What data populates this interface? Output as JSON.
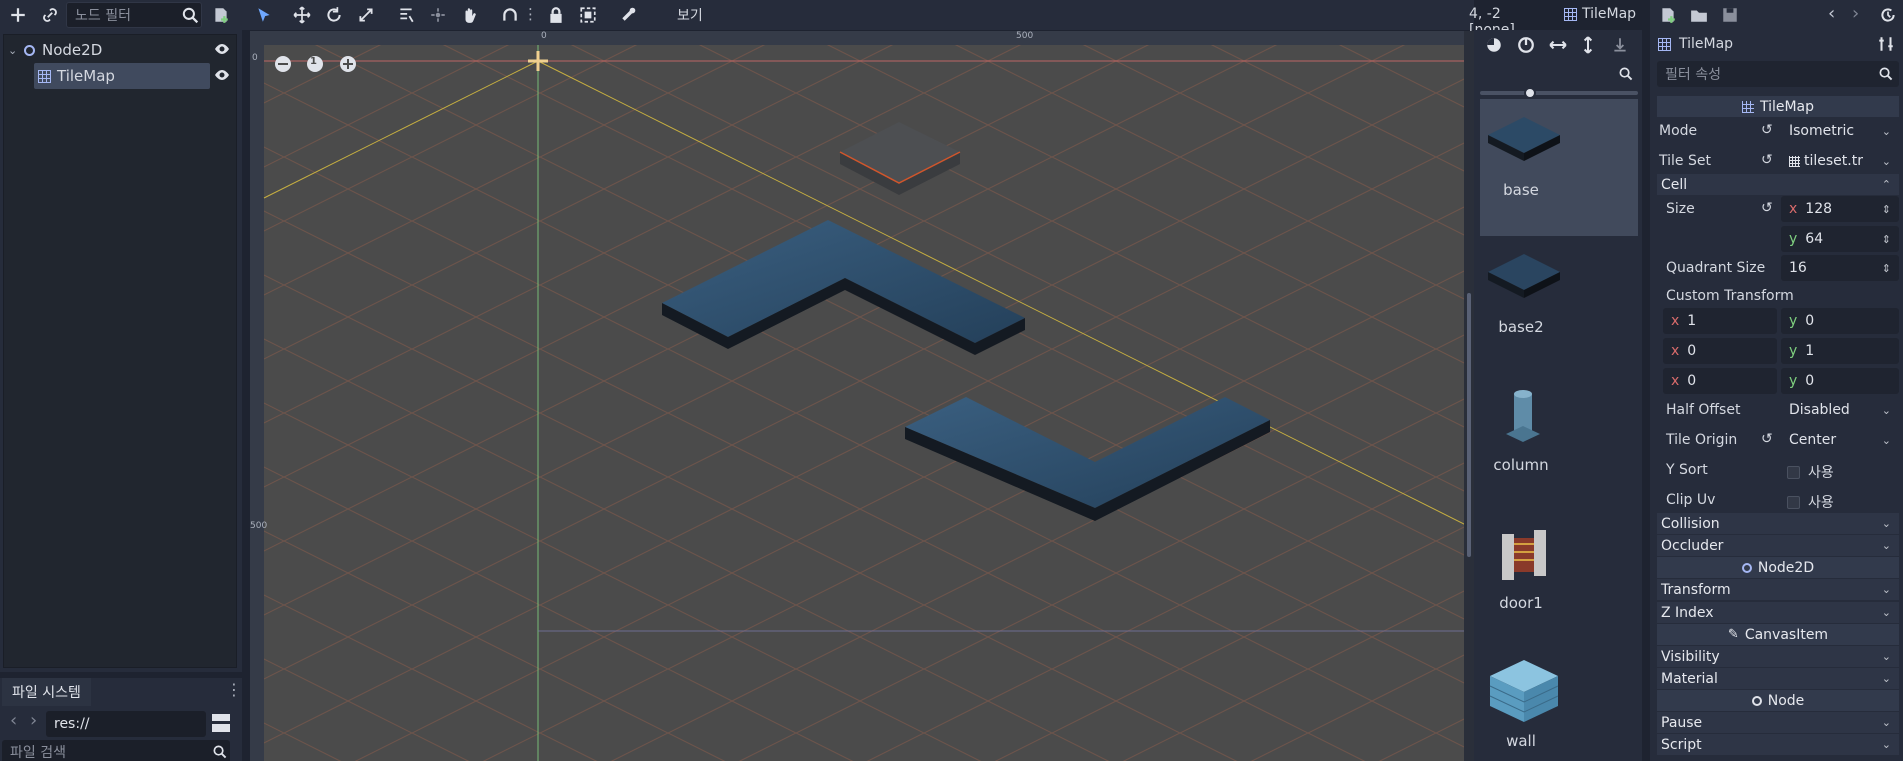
{
  "scene_dock": {
    "filter_placeholder": "노드 필터",
    "nodes": [
      {
        "name": "Node2D"
      },
      {
        "name": "TileMap"
      }
    ]
  },
  "filesystem": {
    "tab": "파일 시스템",
    "path": "res://",
    "search_placeholder": "파일 검색"
  },
  "viewport_toolbar": {
    "view_menu": "보기",
    "cursor_info": "4, -2 [none]",
    "node_label": "TileMap"
  },
  "viewport": {
    "zoom_reset": "1",
    "ruler": {
      "top_0": "0",
      "top_500": "500",
      "left_0": "0",
      "left_500": "500"
    }
  },
  "palette": {
    "tiles": [
      {
        "label": "base"
      },
      {
        "label": "base2"
      },
      {
        "label": "column"
      },
      {
        "label": "door1"
      },
      {
        "label": "wall"
      }
    ]
  },
  "inspector": {
    "node_title": "TileMap",
    "filter_placeholder": "필터 속성",
    "category_tilemap": "TileMap",
    "mode": {
      "label": "Mode",
      "value": "Isometric"
    },
    "tile_set": {
      "label": "Tile Set",
      "value": "tileset.tr"
    },
    "cell_section": "Cell",
    "size": {
      "label": "Size",
      "x": "128",
      "y": "64"
    },
    "quadrant_size": {
      "label": "Quadrant Size",
      "value": "16"
    },
    "custom_transform": {
      "label": "Custom Transform",
      "rows": [
        [
          "1",
          "0"
        ],
        [
          "0",
          "1"
        ],
        [
          "0",
          "0"
        ]
      ]
    },
    "half_offset": {
      "label": "Half Offset",
      "value": "Disabled"
    },
    "tile_origin": {
      "label": "Tile Origin",
      "value": "Center"
    },
    "y_sort": {
      "label": "Y Sort",
      "value": "사용"
    },
    "clip_uv": {
      "label": "Clip Uv",
      "value": "사용"
    },
    "collision": "Collision",
    "occluder": "Occluder",
    "category_node2d": "Node2D",
    "transform": "Transform",
    "z_index": "Z Index",
    "category_canvasitem": "CanvasItem",
    "visibility": "Visibility",
    "material": "Material",
    "category_node": "Node",
    "pause": "Pause",
    "script": "Script"
  },
  "colors": {
    "accent": "#6fa8ff",
    "axis_x": "#d86b6b",
    "axis_y": "#7fcf7f",
    "viewport_bg": "#4b4b4b",
    "tile_blue": "#2c4a66"
  }
}
